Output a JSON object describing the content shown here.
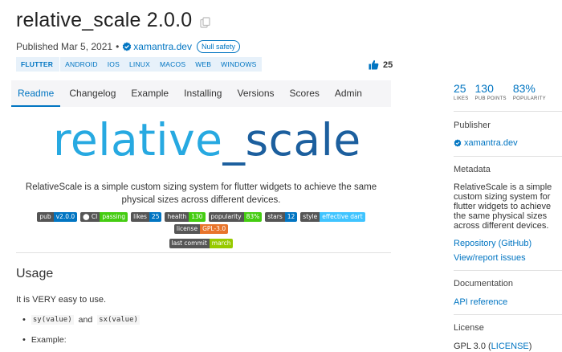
{
  "package": {
    "title": "relative_scale 2.0.0",
    "published": "Published Mar 5, 2021",
    "separator": "•",
    "publisher": "xamantra.dev",
    "null_safety": "Null safety"
  },
  "platforms": {
    "primary": "FLUTTER",
    "items": [
      "ANDROID",
      "IOS",
      "LINUX",
      "MACOS",
      "WEB",
      "WINDOWS"
    ]
  },
  "likes_count": "25",
  "tabs": [
    "Readme",
    "Changelog",
    "Example",
    "Installing",
    "Versions",
    "Scores",
    "Admin"
  ],
  "readme": {
    "logo": {
      "part1": "relative",
      "underscore": "_",
      "part2": "scale"
    },
    "description": "RelativeScale is a simple custom sizing system for flutter widgets to achieve the same physical sizes across different devices.",
    "badges": [
      {
        "label": "pub",
        "value": "v2.0.0",
        "color": "#0175c2"
      },
      {
        "label": "CI",
        "value": "passing",
        "color": "#4c1"
      },
      {
        "label": "likes",
        "value": "25",
        "color": "#0175c2"
      },
      {
        "label": "health",
        "value": "130",
        "color": "#4c1"
      },
      {
        "label": "popularity",
        "value": "83%",
        "color": "#4c1"
      },
      {
        "label": "stars",
        "value": "12",
        "color": "#0175c2"
      },
      {
        "label": "style",
        "value": "effective dart",
        "color": "#40c4ff"
      },
      {
        "label": "license",
        "value": "GPL-3.0",
        "color": "#e8742b"
      },
      {
        "label": "last commit",
        "value": "march",
        "color": "#97ca00"
      }
    ],
    "usage_heading": "Usage",
    "usage_text": "It is VERY easy to use.",
    "bullet1": {
      "code1": "sy(value)",
      "and": "and",
      "code2": "sx(value)"
    },
    "bullet2": "Example:"
  },
  "sidebar": {
    "stats": [
      {
        "value": "25",
        "label": "LIKES"
      },
      {
        "value": "130",
        "label": "PUB POINTS"
      },
      {
        "value": "83%",
        "label": "POPULARITY"
      }
    ],
    "publisher_heading": "Publisher",
    "publisher": "xamantra.dev",
    "metadata_heading": "Metadata",
    "metadata_text": "RelativeScale is a simple custom sizing system for flutter widgets to achieve the same physical sizes across different devices.",
    "repo_link": "Repository (GitHub)",
    "issues_link": "View/report issues",
    "documentation_heading": "Documentation",
    "api_link": "API reference",
    "license_heading": "License",
    "license_prefix": "GPL 3.0 (",
    "license_link": "LICENSE",
    "license_suffix": ")"
  },
  "colors": {
    "accent": "#0175c2",
    "logo_light": "#27a9e1",
    "logo_dark": "#1c5f9e"
  }
}
